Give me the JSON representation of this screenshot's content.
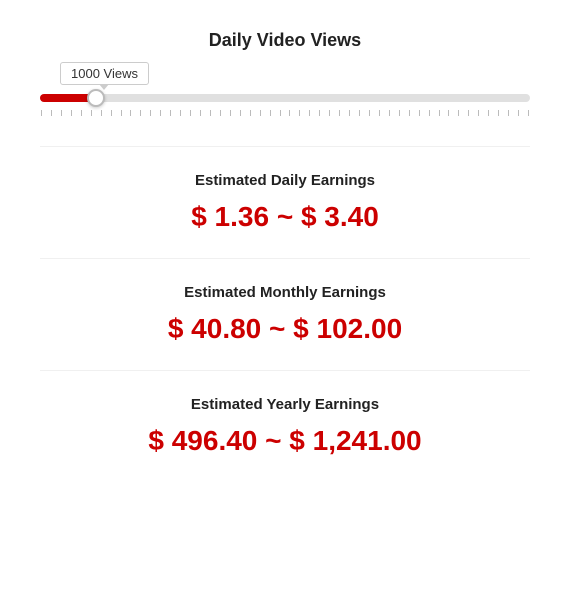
{
  "header": {
    "title": "Daily Video Views"
  },
  "slider": {
    "tooltip": "1000 Views",
    "value": 1000,
    "min": 0,
    "max": 10000,
    "percent": 20
  },
  "earnings": {
    "daily": {
      "label": "Estimated Daily Earnings",
      "value": "$ 1.36 ~ $ 3.40"
    },
    "monthly": {
      "label": "Estimated Monthly Earnings",
      "value": "$ 40.80 ~ $ 102.00"
    },
    "yearly": {
      "label": "Estimated Yearly Earnings",
      "value": "$ 496.40 ~ $ 1,241.00"
    }
  },
  "ticks_count": 50
}
